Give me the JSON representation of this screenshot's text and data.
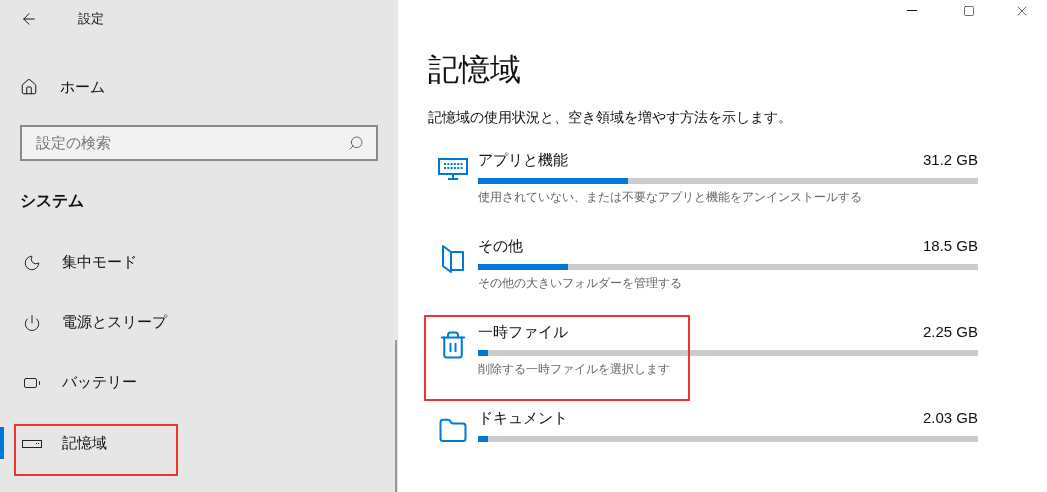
{
  "window": {
    "title": "設定"
  },
  "sidebar": {
    "home": "ホーム",
    "search": {
      "placeholder": "設定の検索"
    },
    "section": "システム",
    "items": [
      {
        "kind": "focus",
        "label": "集中モード",
        "selected": false,
        "highlighted": false
      },
      {
        "kind": "power",
        "label": "電源とスリープ",
        "selected": false,
        "highlighted": false
      },
      {
        "kind": "battery",
        "label": "バッテリー",
        "selected": false,
        "highlighted": false
      },
      {
        "kind": "storage",
        "label": "記憶域",
        "selected": true,
        "highlighted": true
      }
    ]
  },
  "main": {
    "title": "記憶域",
    "description": "記憶域の使用状況と、空き領域を増やす方法を示します。",
    "categories": [
      {
        "kind": "apps",
        "name": "アプリと機能",
        "size": "31.2 GB",
        "level": 0.3,
        "hint": "使用されていない、または不要なアプリと機能をアンインストールする",
        "highlighted": false
      },
      {
        "kind": "other",
        "name": "その他",
        "size": "18.5 GB",
        "level": 0.18,
        "hint": "その他の大きいフォルダーを管理する",
        "highlighted": false
      },
      {
        "kind": "temp",
        "name": "一時ファイル",
        "size": "2.25 GB",
        "level": 0.02,
        "hint": "削除する一時ファイルを選択します",
        "highlighted": true
      },
      {
        "kind": "documents",
        "name": "ドキュメント",
        "size": "2.03 GB",
        "level": 0.02,
        "highlighted": false
      }
    ]
  }
}
